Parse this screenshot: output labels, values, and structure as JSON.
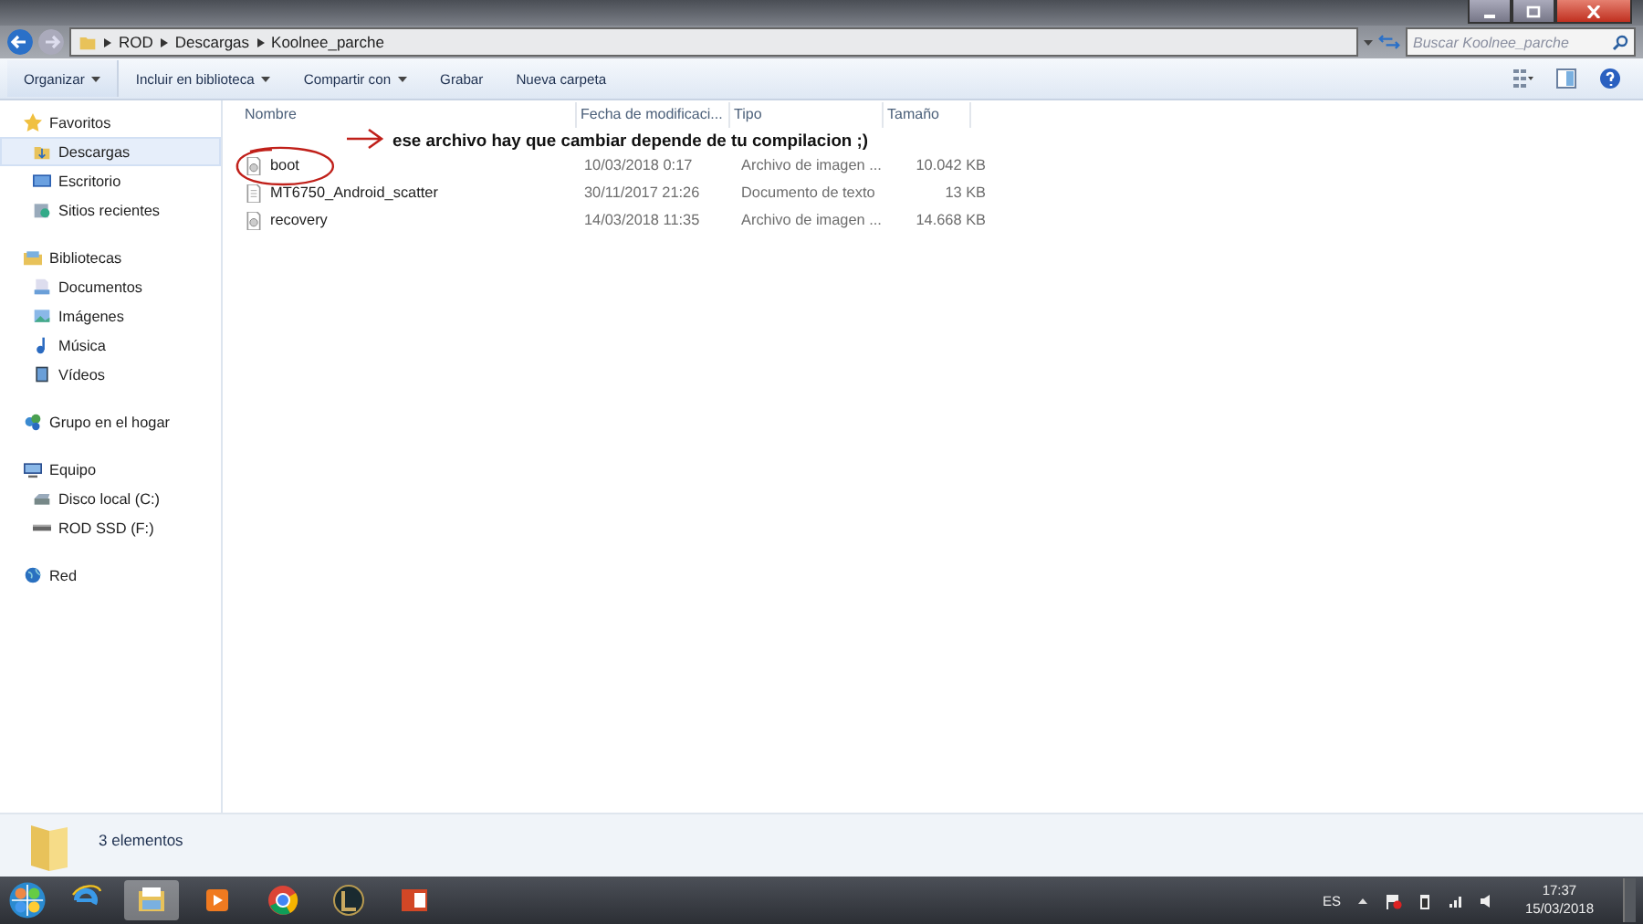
{
  "address_bar": {
    "path": [
      "ROD",
      "Descargas",
      "Koolnee_parche"
    ]
  },
  "search": {
    "placeholder": "Buscar Koolnee_parche"
  },
  "toolbar": [
    {
      "label": "Organizar",
      "dropdown": true
    },
    {
      "label": "Incluir en biblioteca",
      "dropdown": true
    },
    {
      "label": "Compartir con",
      "dropdown": true
    },
    {
      "label": "Grabar",
      "dropdown": false
    },
    {
      "label": "Nueva carpeta",
      "dropdown": false
    }
  ],
  "sidebar": [
    {
      "label": "Favoritos",
      "children": [
        {
          "label": "Descargas",
          "selected": true
        },
        {
          "label": "Escritorio",
          "selected": false
        },
        {
          "label": "Sitios recientes",
          "selected": false
        }
      ]
    },
    {
      "label": "Bibliotecas",
      "children": [
        {
          "label": "Documentos",
          "selected": false
        },
        {
          "label": "Imágenes",
          "selected": false
        },
        {
          "label": "Música",
          "selected": false
        },
        {
          "label": "Vídeos",
          "selected": false
        }
      ]
    },
    {
      "label": "Grupo en el hogar"
    },
    {
      "label": "Equipo",
      "children": [
        {
          "label": "Disco local (C:)",
          "selected": false
        },
        {
          "label": "ROD SSD (F:)",
          "selected": false
        }
      ]
    },
    {
      "label": "Red"
    }
  ],
  "table": {
    "columns": [
      "Nombre",
      "Fecha de modificaci...",
      "Tipo",
      "Tamaño"
    ],
    "rows": [
      {
        "kind": "image",
        "cells": [
          "boot",
          "10/03/2018 0:17",
          "Archivo de imagen ...",
          "10.042 KB"
        ]
      },
      {
        "kind": "text",
        "cells": [
          "MT6750_Android_scatter",
          "30/11/2017 21:26",
          "Documento de texto",
          "13 KB"
        ]
      },
      {
        "kind": "image",
        "cells": [
          "recovery",
          "14/03/2018 11:35",
          "Archivo de imagen ...",
          "14.668 KB"
        ]
      }
    ]
  },
  "annotation": {
    "text": "ese archivo hay que cambiar depende de tu compilacion ;)"
  },
  "status_bar": {
    "text": "3 elementos"
  },
  "taskbar": {
    "language": "ES",
    "time": "17:37",
    "date": "15/03/2018"
  }
}
